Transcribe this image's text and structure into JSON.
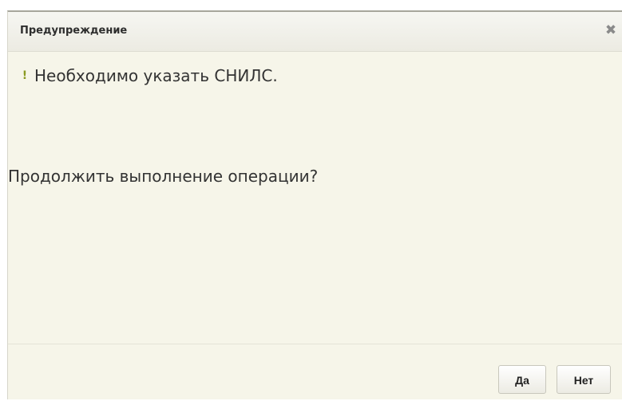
{
  "dialog": {
    "title": "Предупреждение",
    "close_icon": "close-icon",
    "warning_icon": "exclamation-icon",
    "warning_text": "Необходимо указать СНИЛС.",
    "question_text": "Продолжить выполнение операции?",
    "buttons": {
      "yes_label": "Да",
      "no_label": "Нет"
    }
  },
  "colors": {
    "dialog_background": "#f6f5e9",
    "warning_icon": "#8a9a22",
    "text": "#333333"
  }
}
